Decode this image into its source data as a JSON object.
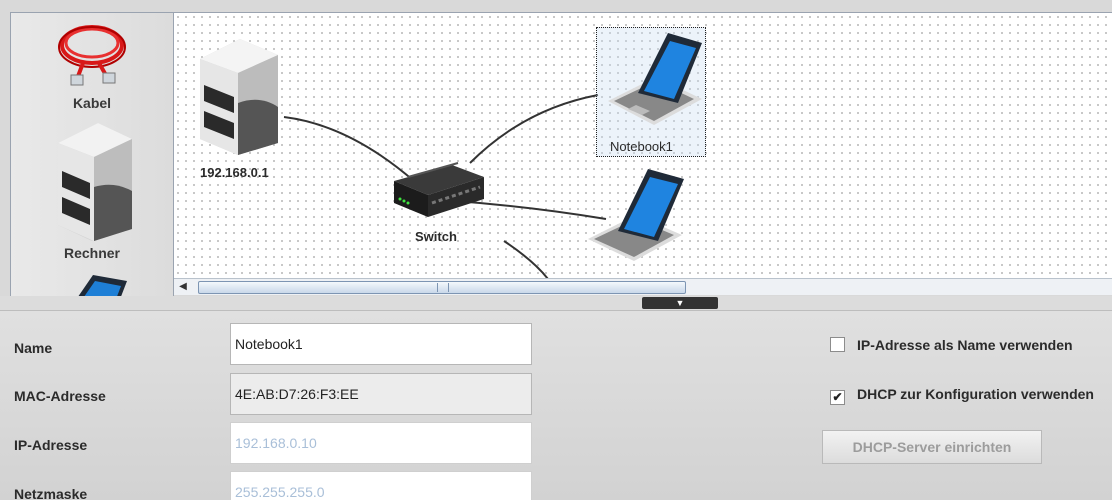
{
  "palette": {
    "items": [
      {
        "label": "Kabel",
        "icon": "cable-icon"
      },
      {
        "label": "Rechner",
        "icon": "computer-icon"
      },
      {
        "label": "",
        "icon": "notebook-icon"
      }
    ]
  },
  "canvas": {
    "nodes": [
      {
        "label": "192.168.0.1",
        "icon": "computer-icon"
      },
      {
        "label": "Switch",
        "icon": "switch-icon"
      },
      {
        "label": "Notebook1",
        "icon": "notebook-icon",
        "selected": true
      },
      {
        "label": "",
        "icon": "notebook-icon"
      }
    ]
  },
  "splitter": {
    "toggle_glyph": "▼"
  },
  "properties": {
    "name": {
      "label": "Name",
      "value": "Notebook1"
    },
    "mac": {
      "label": "MAC-Adresse",
      "value": "4E:AB:D7:26:F3:EE"
    },
    "ip": {
      "label": "IP-Adresse",
      "value": "192.168.0.10"
    },
    "netmask": {
      "label": "Netzmaske",
      "value": "255.255.255.0"
    },
    "use_ip_as_name": {
      "label": "IP-Adresse als Name verwenden",
      "checked": false
    },
    "use_dhcp": {
      "label": "DHCP zur Konfiguration verwenden",
      "checked": true,
      "check_glyph": "✔"
    },
    "dhcp_button": {
      "label": "DHCP-Server einrichten"
    }
  },
  "colors": {
    "selection": "#c8dcf0",
    "link": "#333333",
    "disabled_text": "#a9bfd8"
  }
}
